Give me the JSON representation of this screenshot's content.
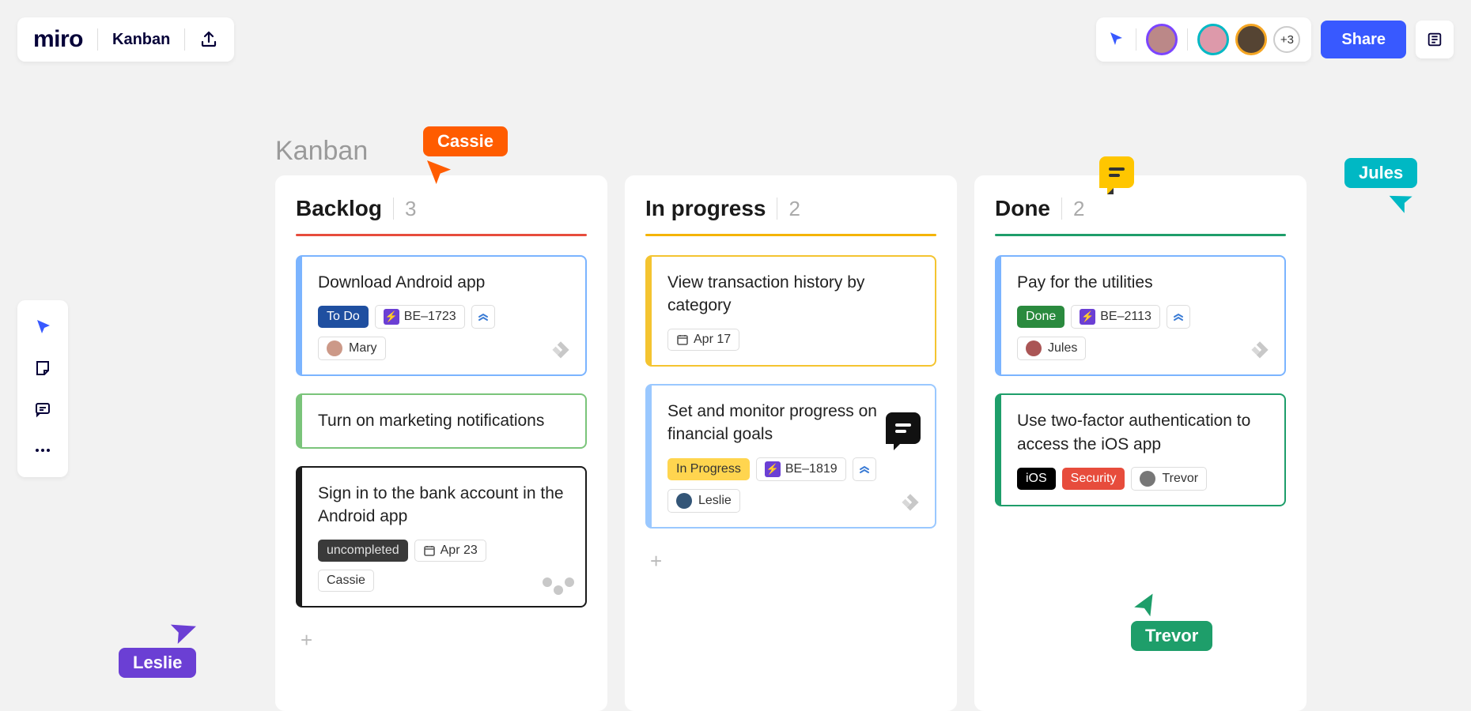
{
  "app": {
    "logo": "miro",
    "title": "Kanban"
  },
  "presence": {
    "extra": "+3",
    "share": "Share"
  },
  "board": {
    "title": "Kanban",
    "columns": [
      {
        "title": "Backlog",
        "count": "3",
        "color": "red",
        "cards": [
          {
            "title": "Download Android app",
            "accent": "blue",
            "status": {
              "label": "To Do",
              "style": "todo"
            },
            "ticket": "BE–1723",
            "priority": true,
            "assignee": "Mary",
            "jira": true
          },
          {
            "title": "Turn on marketing notifications",
            "accent": "green"
          },
          {
            "title": "Sign in to the bank account in the Android app",
            "accent": "black",
            "status": {
              "label": "uncompleted",
              "style": "uncomp"
            },
            "date": "Apr 23",
            "assignee": "Cassie",
            "dots": true
          }
        ]
      },
      {
        "title": "In progress",
        "count": "2",
        "color": "yellow",
        "cards": [
          {
            "title": "View transaction history by category",
            "accent": "yellow",
            "date": "Apr 17"
          },
          {
            "title": "Set and monitor progress on financial goals",
            "accent": "lightblue",
            "status": {
              "label": "In Progress",
              "style": "inprog"
            },
            "ticket": "BE–1819",
            "priority": true,
            "assignee": "Leslie",
            "jira": true
          }
        ]
      },
      {
        "title": "Done",
        "count": "2",
        "color": "green",
        "cards": [
          {
            "title": "Pay for the utilities",
            "accent": "blue",
            "status": {
              "label": "Done",
              "style": "done"
            },
            "ticket": "BE–2113",
            "priority": true,
            "assignee": "Jules",
            "jira": true
          },
          {
            "title": "Use two-factor authentication to access the iOS app",
            "accent": "darkgreen",
            "tags": [
              {
                "label": "iOS",
                "style": "black"
              },
              {
                "label": "Security",
                "style": "red"
              }
            ],
            "assignee": "Trevor"
          }
        ]
      }
    ]
  },
  "cursors": {
    "cassie": "Cassie",
    "leslie": "Leslie",
    "jules": "Jules",
    "trevor": "Trevor"
  }
}
